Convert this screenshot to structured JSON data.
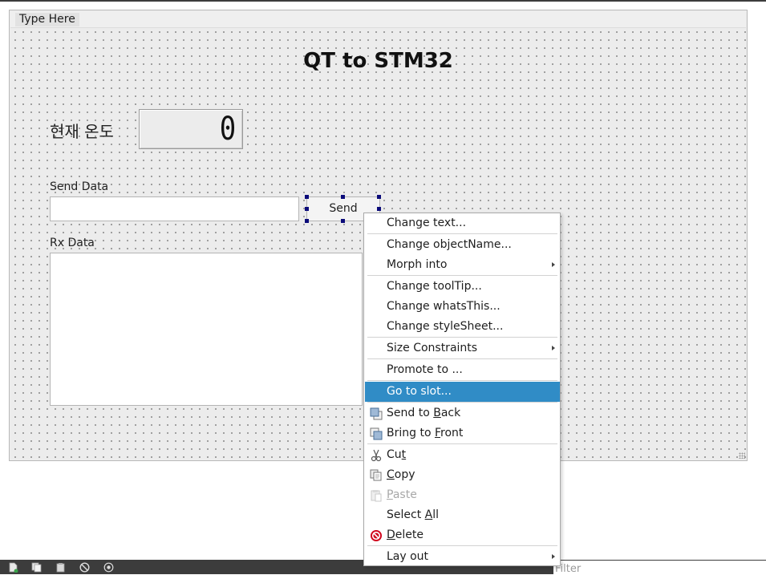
{
  "form": {
    "menu_placeholder": "Type Here",
    "title": "QT to STM32",
    "temperature_label": "현재 온도",
    "lcd_value": "0",
    "send_label": "Send Data",
    "send_input_value": "",
    "send_button": "Send",
    "rx_label": "Rx Data",
    "rx_value": ""
  },
  "context_menu": {
    "items": [
      {
        "label": "Change text..."
      },
      {
        "label": "Change objectName..."
      },
      {
        "label": "Morph into",
        "submenu": true
      },
      {
        "label": "Change toolTip..."
      },
      {
        "label": "Change whatsThis..."
      },
      {
        "label": "Change styleSheet..."
      },
      {
        "label": "Size Constraints",
        "submenu": true
      },
      {
        "label": "Promote to ..."
      },
      {
        "label": "Go to slot...",
        "highlighted": true
      },
      {
        "label_pre": "Send to ",
        "label_mn": "B",
        "label_post": "ack",
        "icon": "send-to-back-icon"
      },
      {
        "label_pre": "Bring to ",
        "label_mn": "F",
        "label_post": "ront",
        "icon": "bring-to-front-icon"
      },
      {
        "label_pre": "Cu",
        "label_mn": "t",
        "label_post": "",
        "icon": "scissors-icon"
      },
      {
        "label_pre": "",
        "label_mn": "C",
        "label_post": "opy",
        "icon": "copy-icon"
      },
      {
        "label_pre": "",
        "label_mn": "P",
        "label_post": "aste",
        "icon": "paste-icon",
        "disabled": true
      },
      {
        "label_pre": "Select ",
        "label_mn": "A",
        "label_post": "ll"
      },
      {
        "label_pre": "",
        "label_mn": "D",
        "label_post": "elete",
        "icon": "delete-icon"
      },
      {
        "label": "Lay out",
        "submenu": true
      }
    ]
  },
  "bottom_bar": {
    "icons": [
      "new-file-icon",
      "copy-icon",
      "paste-icon",
      "forbidden-icon",
      "settings-icon"
    ],
    "filter_placeholder": "Filter"
  },
  "colors": {
    "highlight": "#308cc6",
    "selection_handle": "#0b0b7a",
    "form_background": "#ececec",
    "dock_bar": "#3c3c3c",
    "delete_icon": "#d0021b"
  }
}
